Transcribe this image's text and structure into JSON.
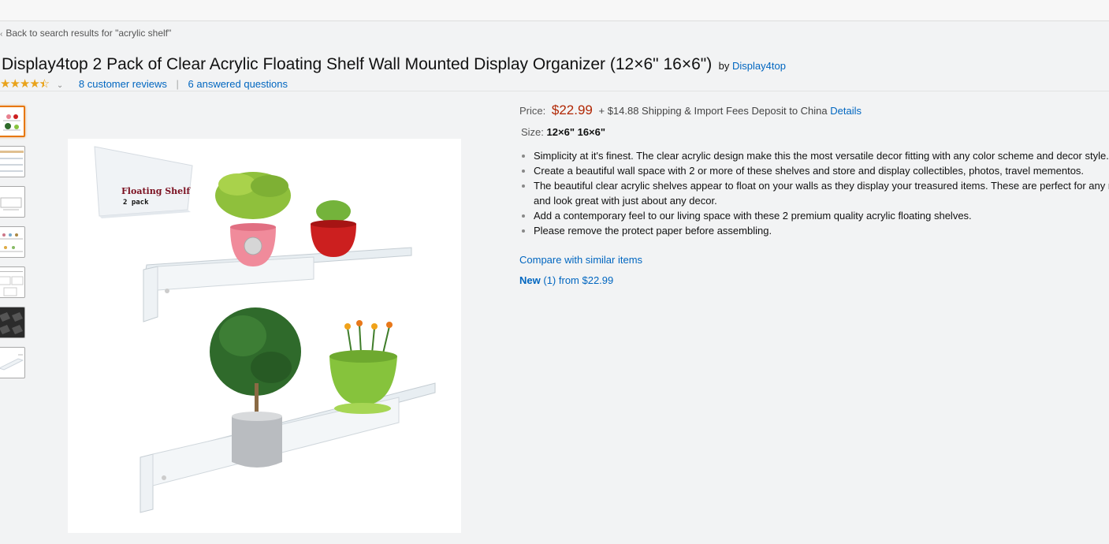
{
  "breadcrumb": {
    "back_label": "Back to search results for \"acrylic shelf\""
  },
  "product": {
    "title": "Display4top 2 Pack of Clear Acrylic Floating Shelf Wall Mounted Display Organizer (12×6\" 16×6\")",
    "by_label": "by",
    "brand": "Display4top",
    "rating_stars": 4.5,
    "reviews_label": "8 customer reviews",
    "questions_label": "6 answered questions"
  },
  "image": {
    "badge_line1": "Floating Shelf",
    "badge_line2": "2 pack"
  },
  "thumbnails": [
    {
      "name": "thumb-1",
      "selected": true
    },
    {
      "name": "thumb-2",
      "selected": false
    },
    {
      "name": "thumb-3",
      "selected": false
    },
    {
      "name": "thumb-4",
      "selected": false
    },
    {
      "name": "thumb-5",
      "selected": false
    },
    {
      "name": "thumb-6",
      "selected": false
    },
    {
      "name": "thumb-7",
      "selected": false
    }
  ],
  "buybox": {
    "price_label": "Price:",
    "price": "$22.99",
    "shipping": "+ $14.88 Shipping & Import Fees Deposit to China",
    "details_link": "Details",
    "size_label": "Size:",
    "size_value": "12×6\" 16×6\""
  },
  "bullets": [
    "Simplicity at it's finest. The clear acrylic design make this the most versatile decor fitting with any color scheme and decor style.",
    "Create a beautiful wall space with 2 or more of these shelves and store and display collectibles, photos, travel mementos.",
    "The beautiful clear acrylic shelves appear to float on your walls as they display your treasured items. These are perfect for any room and look great with just about any decor.",
    "Add a contemporary feel to our living space with these 2 premium quality acrylic floating shelves.",
    "Please remove the protect paper before assembling."
  ],
  "compare_link": "Compare with similar items",
  "offers": {
    "new_label": "New",
    "count": "(1)",
    "from": "from $22.99"
  },
  "colors": {
    "link": "#0066c0",
    "price": "#b12704",
    "star": "#e9a31b",
    "selected_border": "#e77600"
  }
}
